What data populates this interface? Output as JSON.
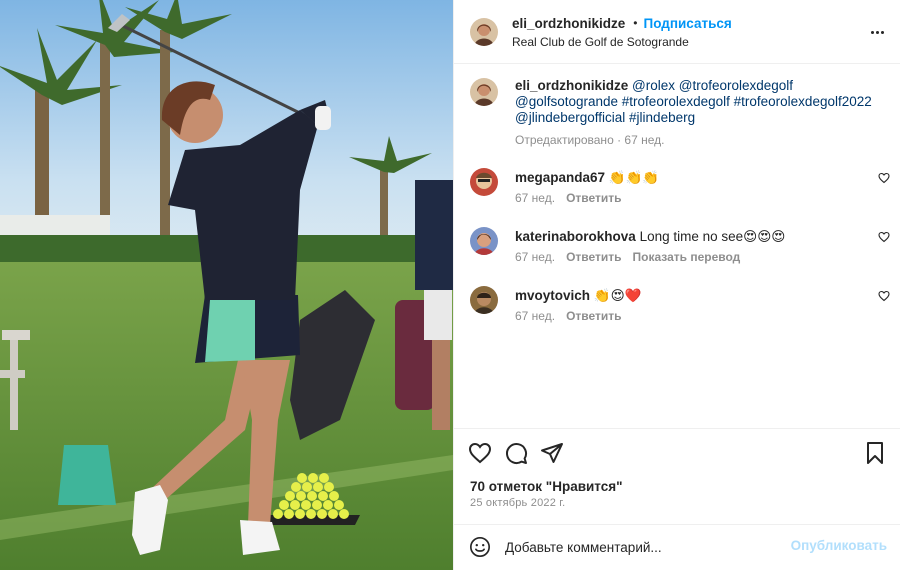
{
  "post": {
    "author": "eli_ordzhonikidze",
    "separator": "•",
    "follow_label": "Подписаться",
    "location": "Real Club de Golf de Sotogrande"
  },
  "caption": {
    "user": "eli_ordzhonikidze",
    "tags": [
      "@rolex",
      "@trofeorolexdegolf",
      "@golfsotogrande",
      "#trofeorolexdegolf",
      "#trofeorolexdegolf2022",
      "@jlindebergofficial",
      "#jlindeberg"
    ],
    "edited_label": "Отредактировано",
    "age": "67 нед."
  },
  "comments": [
    {
      "user": "megapanda67",
      "text": "👏👏👏",
      "age": "67 нед.",
      "reply": "Ответить",
      "translate": ""
    },
    {
      "user": "katerinaborokhova",
      "text": "Long time no see😍😍😍",
      "age": "67 нед.",
      "reply": "Ответить",
      "translate": "Показать перевод"
    },
    {
      "user": "mvoytovich",
      "text": "👏😍❤️",
      "age": "67 нед.",
      "reply": "Ответить",
      "translate": ""
    }
  ],
  "actions": {
    "likes": "70 отметок \"Нравится\"",
    "date": "25 октябрь 2022 г.",
    "icons": [
      "heart-icon",
      "comment-icon",
      "share-icon",
      "bookmark-icon"
    ]
  },
  "add_comment": {
    "placeholder": "Добавьте комментарий...",
    "publish_label": "Опубликовать"
  },
  "colors": {
    "link": "#0095f6",
    "hashtag": "#00376b",
    "muted": "#8e8e8e",
    "publish_disabled": "#b2dffc"
  }
}
